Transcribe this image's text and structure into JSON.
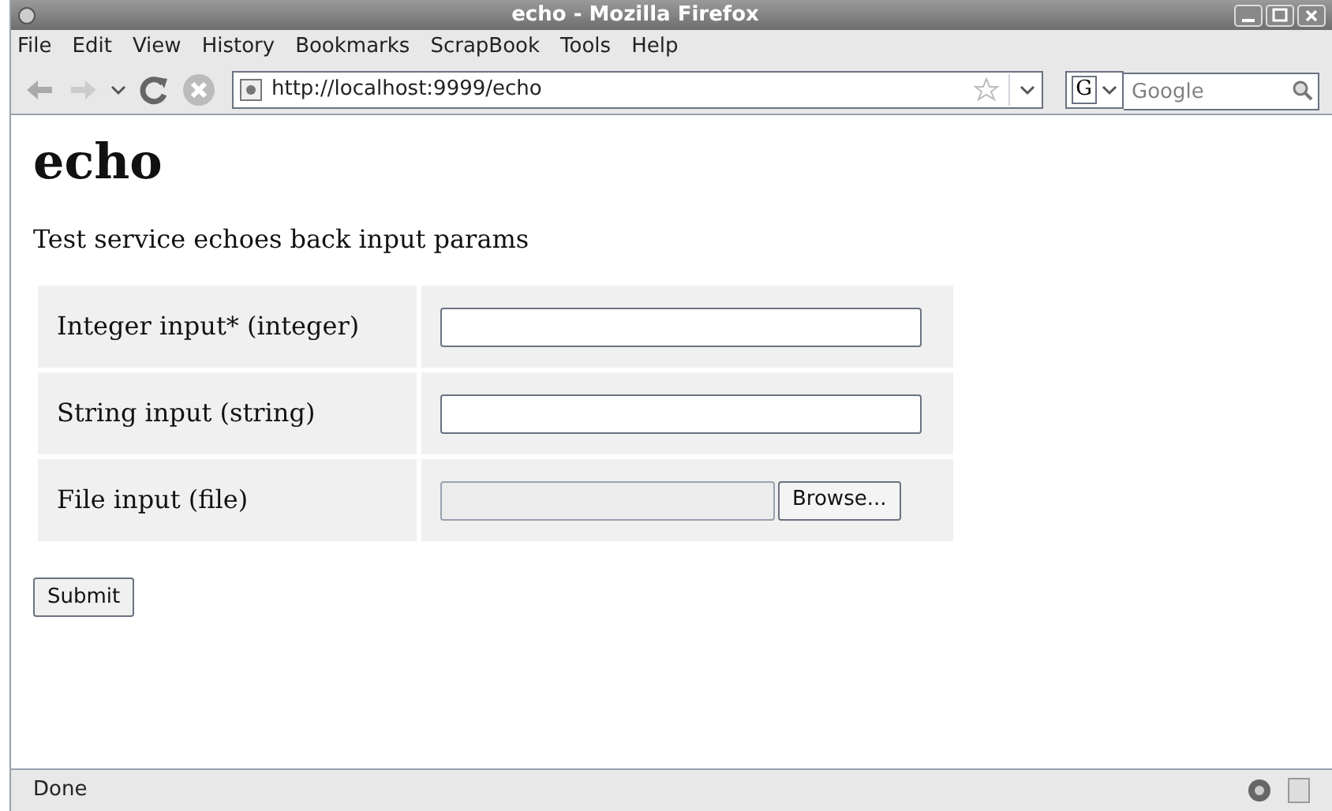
{
  "window": {
    "title": "echo - Mozilla Firefox"
  },
  "menu": [
    "File",
    "Edit",
    "View",
    "History",
    "Bookmarks",
    "ScrapBook",
    "Tools",
    "Help"
  ],
  "toolbar": {
    "url": "http://localhost:9999/echo",
    "search_placeholder": "Google",
    "search_engine": "G"
  },
  "page": {
    "heading": "echo",
    "description": "Test service echoes back input params",
    "fields": [
      {
        "kind": "text",
        "label": "Integer input* (integer)"
      },
      {
        "kind": "text",
        "label": "String input (string)"
      },
      {
        "kind": "file",
        "label": "File input (file)",
        "button": "Browse..."
      }
    ],
    "submit": "Submit"
  },
  "status_bar": {
    "text": "Done"
  }
}
